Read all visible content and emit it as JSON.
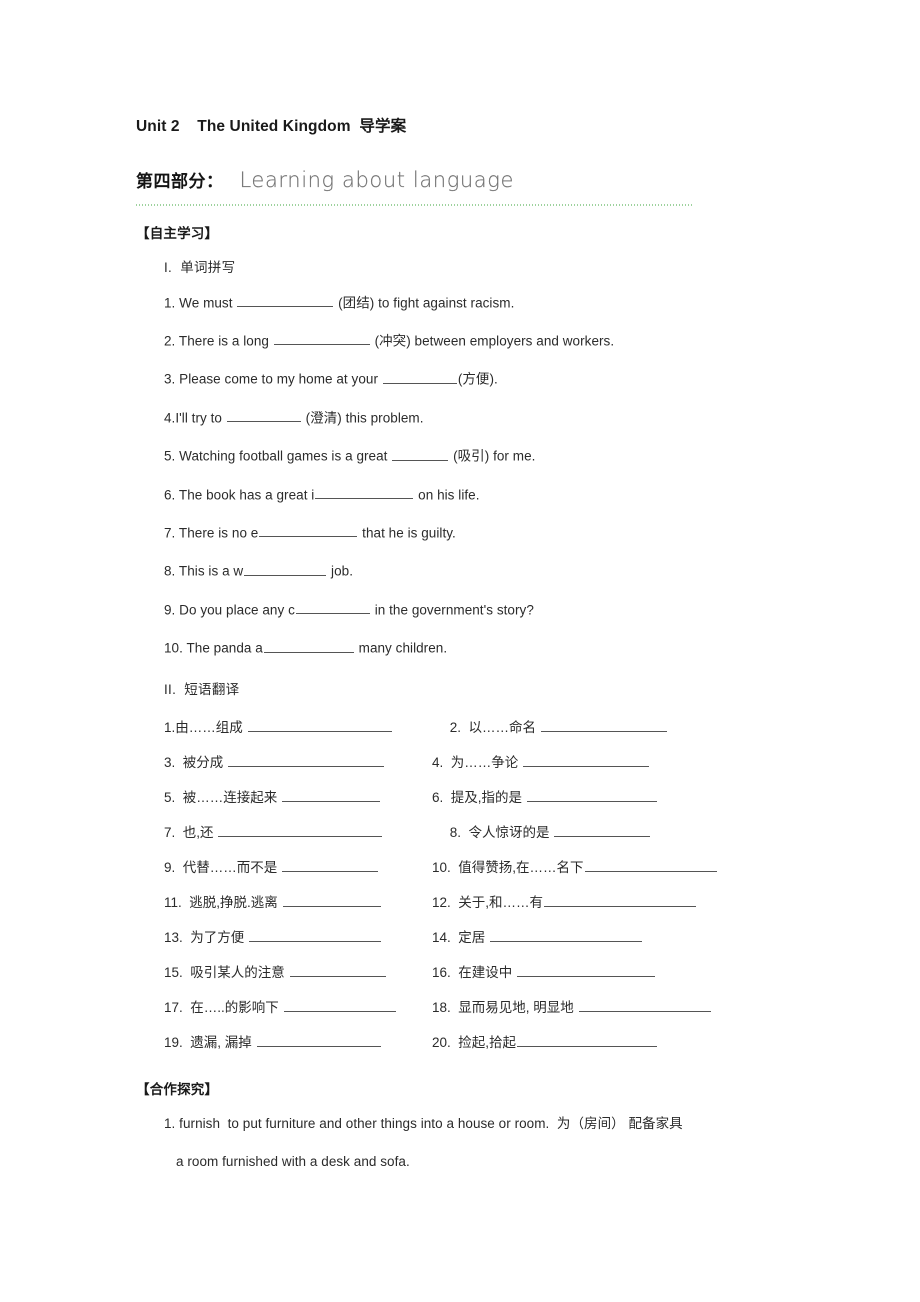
{
  "document": {
    "title": "Unit 2    The United Kingdom  导学案",
    "part_label": "第四部分：",
    "part_title": "Learning about language"
  },
  "sections": {
    "self_study": {
      "heading": "【自主学习】",
      "spelling": {
        "heading": "I.  单词拼写",
        "items": [
          {
            "pre": "1. We must ",
            "blank": 96,
            "post": " (团结) to fight against racism."
          },
          {
            "pre": "2. There is a long ",
            "blank": 96,
            "post": " (冲突) between employers and workers."
          },
          {
            "pre": "3. Please come to my home at your ",
            "blank": 74,
            "post": "(方便)."
          },
          {
            "pre": "4.I'll try to ",
            "blank": 74,
            "post": " (澄清) this problem."
          },
          {
            "pre": "5. Watching football games is a great ",
            "blank": 56,
            "post": " (吸引) for me."
          },
          {
            "pre": "6. The book has a great i",
            "blank": 98,
            "post": " on his life."
          },
          {
            "pre": "7. There is no e",
            "blank": 98,
            "post": " that he is guilty."
          },
          {
            "pre": "8. This is a w",
            "blank": 82,
            "post": " job."
          },
          {
            "pre": "9. Do you place any c",
            "blank": 74,
            "post": " in the government's story?"
          },
          {
            "pre": "10. The panda a",
            "blank": 90,
            "post": " many children."
          }
        ]
      },
      "phrases": {
        "heading": "II.  短语翻译",
        "rows": [
          {
            "left": {
              "text": "1.由……组成 ",
              "blank": 144,
              "tail": ""
            },
            "right": {
              "text": " 2.  以……命名 ",
              "blank": 126,
              "tail": "",
              "shift": true
            }
          },
          {
            "left": {
              "text": "3.  被分成 ",
              "blank": 156,
              "tail": ""
            },
            "right": {
              "text": "4.  为……争论 ",
              "blank": 126,
              "tail": "",
              "shift": false
            }
          },
          {
            "left": {
              "text": "5.  被……连接起来 ",
              "blank": 98,
              "tail": ""
            },
            "right": {
              "text": "6.  提及,指的是 ",
              "blank": 130,
              "tail": "",
              "shift": false
            }
          },
          {
            "left": {
              "text": "7.  也,还 ",
              "blank": 164,
              "tail": ""
            },
            "right": {
              "text": " 8.  令人惊讶的是 ",
              "blank": 96,
              "tail": "",
              "shift": true
            }
          },
          {
            "left": {
              "text": "9.  代替……而不是 ",
              "blank": 96,
              "tail": ""
            },
            "right": {
              "text": "10.  值得赞扬,在……名下",
              "blank": 132,
              "tail": "",
              "shift": false
            }
          },
          {
            "left": {
              "text": "11.  逃脱,挣脱.逃离 ",
              "blank": 98,
              "tail": ""
            },
            "right": {
              "text": "12.  关于,和……有",
              "blank": 152,
              "tail": "",
              "shift": false
            }
          },
          {
            "left": {
              "text": "13.  为了方便 ",
              "blank": 132,
              "tail": ""
            },
            "right": {
              "text": "14.  定居 ",
              "blank": 152,
              "tail": "",
              "shift": false
            }
          },
          {
            "left": {
              "text": "15.  吸引某人的注意 ",
              "blank": 96,
              "tail": ""
            },
            "right": {
              "text": "16.  在建设中 ",
              "blank": 138,
              "tail": "",
              "shift": false
            }
          },
          {
            "left": {
              "text": "17.  在…..的影响下 ",
              "blank": 112,
              "tail": ""
            },
            "right": {
              "text": "18.  显而易见地, 明显地 ",
              "blank": 132,
              "tail": "",
              "shift": false
            }
          },
          {
            "left": {
              "text": "19.  遗漏, 漏掉 ",
              "blank": 124,
              "tail": ""
            },
            "right": {
              "text": "20.  捡起,拾起",
              "blank": 140,
              "tail": "",
              "shift": false
            }
          }
        ]
      }
    },
    "cooperative_inquiry": {
      "heading": "【合作探究】",
      "lines": [
        "1. furnish  to put furniture and other things into a house or room.  为（房间） 配备家具",
        "a room furnished with a desk and sofa."
      ]
    }
  },
  "colors": {
    "text": "#2b2b2b",
    "heading": "#1a1a1a",
    "divider": "#9ed29e",
    "part_title": "#6f6f6f",
    "blank_rule": "#555555"
  }
}
